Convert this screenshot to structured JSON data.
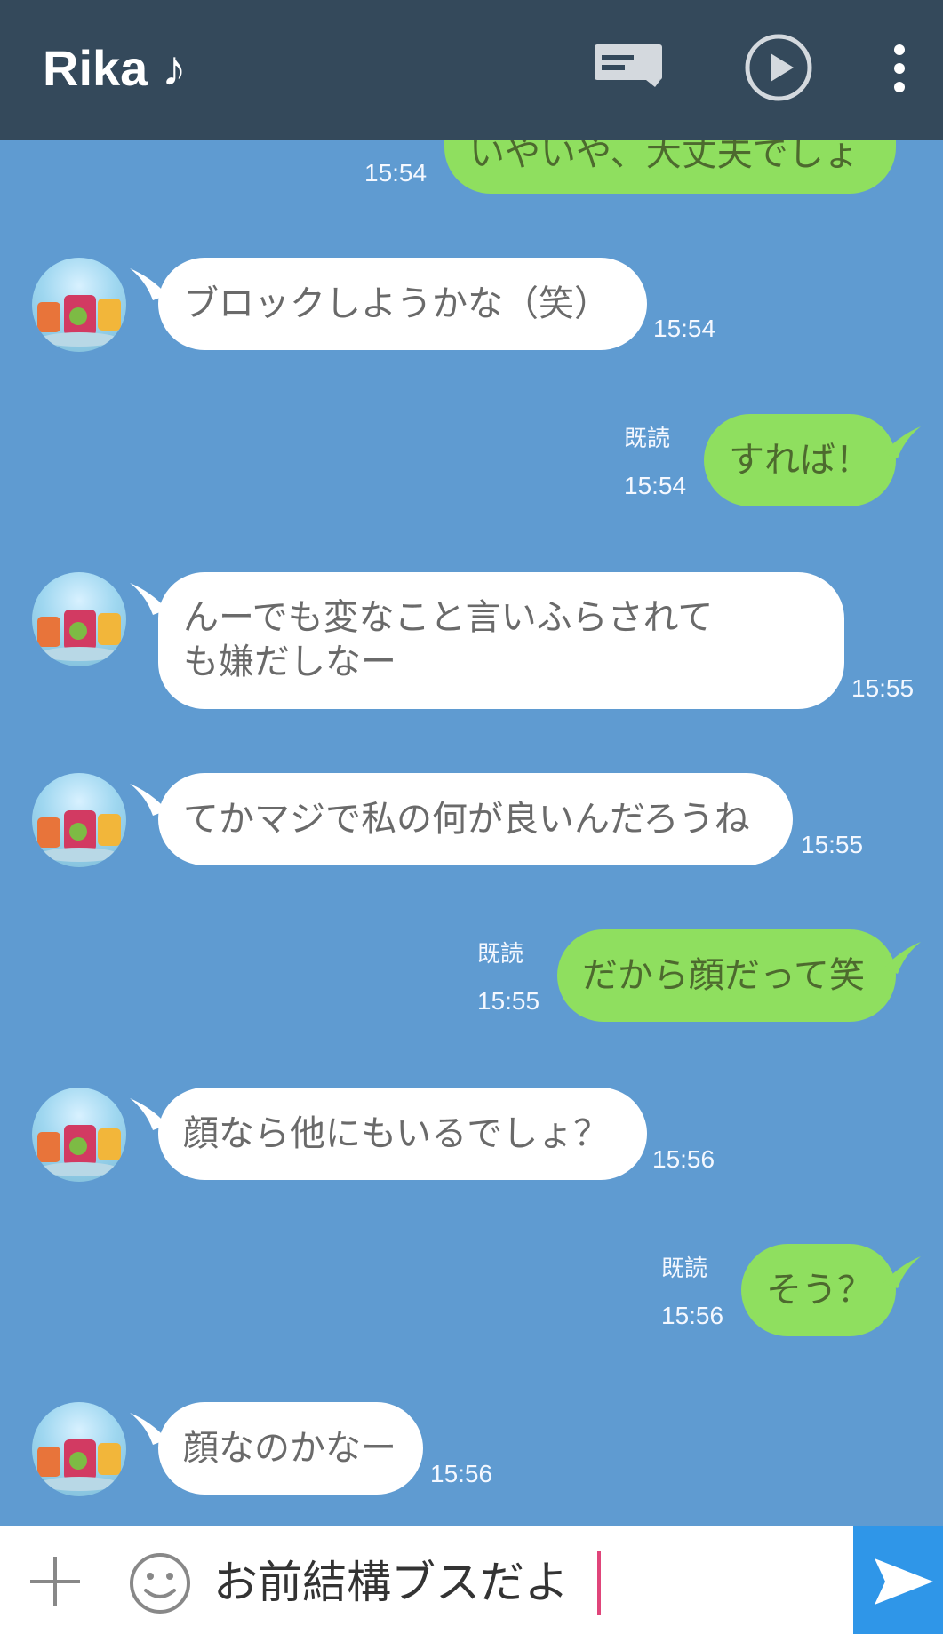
{
  "header": {
    "title": "Rika ♪",
    "icons": [
      "note-icon",
      "play-icon",
      "more-vert-icon"
    ],
    "background": "#34495b"
  },
  "messages": [
    {
      "side": "out",
      "text": "いやいや、大丈夫でしょ",
      "time": "15:54"
    },
    {
      "side": "in",
      "text": "ブロックしようかな（笑）",
      "time": "15:54"
    },
    {
      "side": "out",
      "read": "既読",
      "text": "すれば！",
      "time": "15:54"
    },
    {
      "side": "in",
      "text": "んーでも変なこと言いふらされても嫌だしなー",
      "line1": "んーでも変なこと言いふらされて",
      "line2": "も嫌だしなー",
      "time": "15:55"
    },
    {
      "side": "in",
      "text": "てかマジで私の何が良いんだろうね",
      "time": "15:55"
    },
    {
      "side": "out",
      "read": "既読",
      "text": "だから顔だって笑",
      "time": "15:55"
    },
    {
      "side": "in",
      "text": "顔なら他にもいるでしょ？",
      "time": "15:56"
    },
    {
      "side": "out",
      "read": "既読",
      "text": "そう？",
      "time": "15:56"
    },
    {
      "side": "in",
      "text": "顔なのかなー",
      "time": "15:56"
    }
  ],
  "input": {
    "value": "お前結構ブスだよ"
  },
  "colors": {
    "chat_bg": "#5f9bd1",
    "incoming_bubble": "#ffffff",
    "outgoing_bubble": "#8fdf5f",
    "send_button": "#2f96e8"
  }
}
